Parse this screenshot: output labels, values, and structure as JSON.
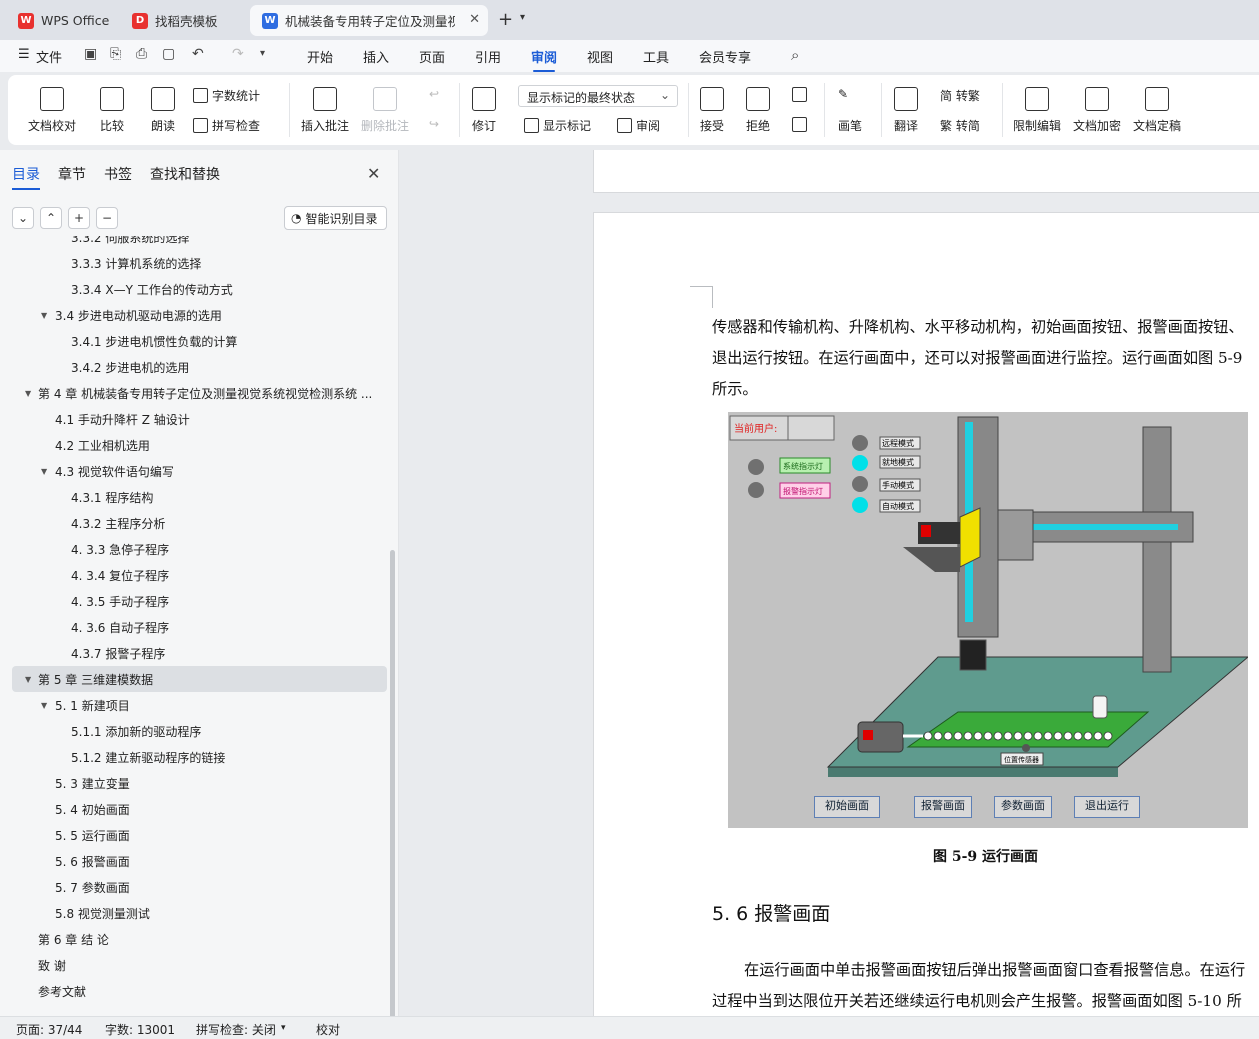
{
  "tabs": [
    {
      "label": "WPS Office",
      "icon": "wps-logo-icon",
      "color": "#e8312f"
    },
    {
      "label": "找稻壳模板",
      "icon": "docer-logo-icon",
      "color": "#e8312f"
    },
    {
      "label": "机械装备专用转子定位及测量视",
      "icon": "word-doc-icon",
      "color": "#2f6de1"
    }
  ],
  "menu": {
    "file": "文件",
    "items": [
      "开始",
      "插入",
      "页面",
      "引用",
      "审阅",
      "视图",
      "工具",
      "会员专享"
    ],
    "active": "审阅"
  },
  "ribbon": {
    "doc_check": "文档校对",
    "compare": "比较",
    "read": "朗读",
    "word_count": "字数统计",
    "spell": "拼写检查",
    "insert_comment": "插入批注",
    "delete_comment": "删除批注",
    "revise": "修订",
    "dropdown_value": "显示标记的最终状态",
    "show_marks": "显示标记",
    "review": "审阅",
    "accept": "接受",
    "reject": "拒绝",
    "pen": "画笔",
    "translate": "翻译",
    "to_trad": "简 转繁",
    "to_simp": "繁 转简",
    "restrict": "限制编辑",
    "encrypt": "文档加密",
    "finalize": "文档定稿"
  },
  "sidebar": {
    "tabs": [
      "目录",
      "章节",
      "书签",
      "查找和替换"
    ],
    "smart_button": "智能识别目录",
    "toc": [
      {
        "t": "3.3.2 伺服系统的选择",
        "l": 3,
        "a": ""
      },
      {
        "t": "3.3.3 计算机系统的选择",
        "l": 3,
        "a": ""
      },
      {
        "t": "3.3.4 X—Y 工作台的传动方式",
        "l": 3,
        "a": ""
      },
      {
        "t": "3.4 步进电动机驱动电源的选用",
        "l": 2,
        "a": "▼"
      },
      {
        "t": "3.4.1 步进电机惯性负载的计算",
        "l": 3,
        "a": ""
      },
      {
        "t": "3.4.2 步进电机的选用",
        "l": 3,
        "a": ""
      },
      {
        "t": "第 4 章 机械装备专用转子定位及测量视觉系统视觉检测系统 ...",
        "l": 1,
        "a": "▼"
      },
      {
        "t": "4.1 手动升降杆 Z 轴设计",
        "l": 2,
        "a": ""
      },
      {
        "t": "4.2 工业相机选用",
        "l": 2,
        "a": ""
      },
      {
        "t": "4.3 视觉软件语句编写",
        "l": 2,
        "a": "▼"
      },
      {
        "t": "4.3.1 程序结构",
        "l": 3,
        "a": ""
      },
      {
        "t": "4.3.2 主程序分析",
        "l": 3,
        "a": ""
      },
      {
        "t": "4. 3.3 急停子程序",
        "l": 3,
        "a": ""
      },
      {
        "t": "4. 3.4 复位子程序",
        "l": 3,
        "a": ""
      },
      {
        "t": "4. 3.5 手动子程序",
        "l": 3,
        "a": ""
      },
      {
        "t": "4. 3.6 自动子程序",
        "l": 3,
        "a": ""
      },
      {
        "t": "4.3.7 报警子程序",
        "l": 3,
        "a": ""
      },
      {
        "t": "第 5 章 三维建模数据",
        "l": 1,
        "a": "▼",
        "sel": true
      },
      {
        "t": "5. 1 新建项目",
        "l": 2,
        "a": "▼"
      },
      {
        "t": "5.1.1 添加新的驱动程序",
        "l": 3,
        "a": ""
      },
      {
        "t": "5.1.2 建立新驱动程序的链接",
        "l": 3,
        "a": ""
      },
      {
        "t": "5. 3 建立变量",
        "l": 2,
        "a": ""
      },
      {
        "t": "5. 4 初始画面",
        "l": 2,
        "a": ""
      },
      {
        "t": "5. 5 运行画面",
        "l": 2,
        "a": ""
      },
      {
        "t": "5. 6 报警画面",
        "l": 2,
        "a": ""
      },
      {
        "t": "5. 7 参数画面",
        "l": 2,
        "a": ""
      },
      {
        "t": "5.8 视觉测量测试",
        "l": 2,
        "a": ""
      },
      {
        "t": "第 6 章 结 论",
        "l": 1,
        "a": ""
      },
      {
        "t": "致 谢",
        "l": 1,
        "a": ""
      },
      {
        "t": "参考文献",
        "l": 1,
        "a": ""
      }
    ]
  },
  "document": {
    "p1": [
      "传感器和传输机构、升降机构、水平移动机构，初始画面按钮、报警画面按钮、",
      "退出运行按钮。在运行画面中，还可以对报警画面进行监控。运行画面如图 5-9",
      "所示。"
    ],
    "figure": {
      "user_label": "当前用户:",
      "lamps": [
        "系统指示灯",
        "报警指示灯"
      ],
      "modes": [
        "远程模式",
        "就地模式",
        "手动模式",
        "自动模式"
      ],
      "sensor_label": "位置传感器",
      "buttons": [
        "初始画面",
        "报警画面",
        "参数画面",
        "退出运行"
      ]
    },
    "caption": "图 5-9 运行画面",
    "heading": "5. 6 报警画面",
    "p2": [
      "在运行画面中单击报警画面按钮后弹出报警画面窗口查看报警信息。在运行",
      "过程中当到达限位开关若还继续运行电机则会产生报警。报警画面如图 5-10 所"
    ]
  },
  "status": {
    "page": "页面: 37/44",
    "words": "字数: 13001",
    "spell": "拼写检查: 关闭",
    "proof": "校对"
  }
}
